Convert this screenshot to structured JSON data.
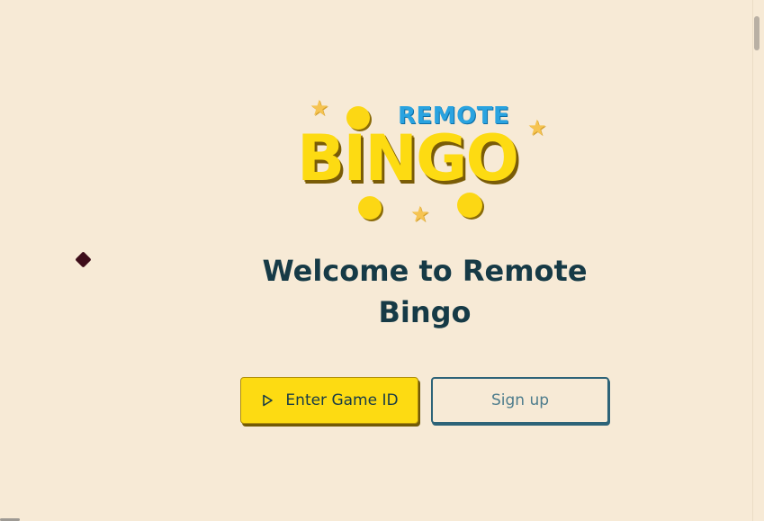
{
  "logo": {
    "top_word": "REMOTE",
    "main_word": "BINGO"
  },
  "welcome": {
    "line1": "Welcome to Remote",
    "line2": "Bingo"
  },
  "actions": {
    "enter_game_label": "Enter Game ID",
    "signup_label": "Sign up"
  },
  "icons": {
    "play": "play-icon",
    "star": "star-icon",
    "diamond": "diamond-icon"
  },
  "colors": {
    "background": "#f7ead6",
    "primary_yellow": "#fddb12",
    "heading": "#163a46",
    "secondary_border": "#2d6378",
    "remote_blue": "#29a3e0"
  }
}
